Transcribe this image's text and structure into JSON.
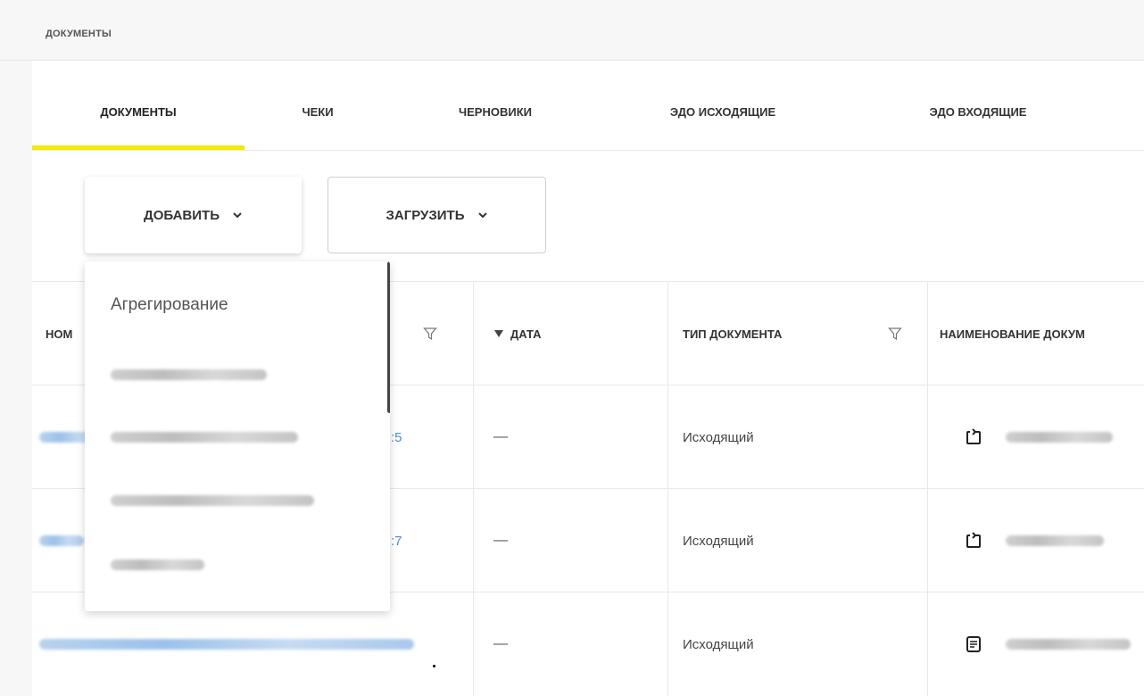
{
  "breadcrumb": "ДОКУМЕНТЫ",
  "tabs": [
    {
      "label": "ДОКУМЕНТЫ",
      "active": true
    },
    {
      "label": "ЧЕКИ",
      "active": false
    },
    {
      "label": "ЧЕРНОВИКИ",
      "active": false
    },
    {
      "label": "ЭДО ИСХОДЯЩИЕ",
      "active": false
    },
    {
      "label": "ЭДО ВХОДЯЩИЕ",
      "active": false
    }
  ],
  "toolbar": {
    "add_label": "ДОБАВИТЬ",
    "upload_label": "ЗАГРУЗИТЬ"
  },
  "dropdown": {
    "items": [
      "Агрегирование"
    ]
  },
  "table": {
    "headers": {
      "number": "НОМ",
      "date": "ДАТА",
      "doc_type": "ТИП ДОКУМЕНТА",
      "doc_name": "НАИМЕНОВАНИЕ ДОКУМ"
    },
    "rows": [
      {
        "number_suffix": ":5",
        "date": "—",
        "doc_type": "Исходящий",
        "icon": "sync-doc-icon"
      },
      {
        "number_suffix": ":7",
        "date": "—",
        "doc_type": "Исходящий",
        "icon": "sync-doc-icon"
      },
      {
        "number_suffix": "",
        "date": "—",
        "doc_type": "Исходящий",
        "icon": "document-icon"
      }
    ]
  },
  "colors": {
    "accent": "#f2ea00",
    "link": "#4a8fd8"
  }
}
